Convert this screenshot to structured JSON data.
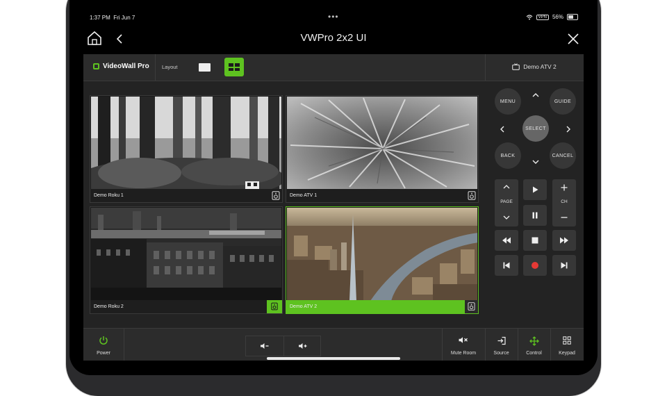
{
  "status": {
    "time": "1:37 PM",
    "date": "Fri Jun 7",
    "vpn": "VPN",
    "battery": "56%"
  },
  "nav": {
    "title": "VWPro 2x2 UI"
  },
  "app": {
    "brand": "VideoWall Pro",
    "layout_label": "Layout",
    "selected_device": "Demo ATV 2",
    "selected_layout": "2x2"
  },
  "tiles": [
    {
      "label": "Demo Roku 1"
    },
    {
      "label": "Demo ATV 1"
    },
    {
      "label": "Demo Roku 2"
    },
    {
      "label": "Demo ATV 2"
    }
  ],
  "remote": {
    "menu": "MENU",
    "guide": "GUIDE",
    "select": "SELECT",
    "back": "BACK",
    "cancel": "CANCEL",
    "page": "PAGE",
    "ch": "CH"
  },
  "bottom": {
    "power": "Power",
    "mute": "Mute Room",
    "source": "Source",
    "control": "Control",
    "keypad": "Keypad"
  },
  "colors": {
    "accent": "#5ec220",
    "record": "#e53935",
    "panel": "#232323"
  }
}
